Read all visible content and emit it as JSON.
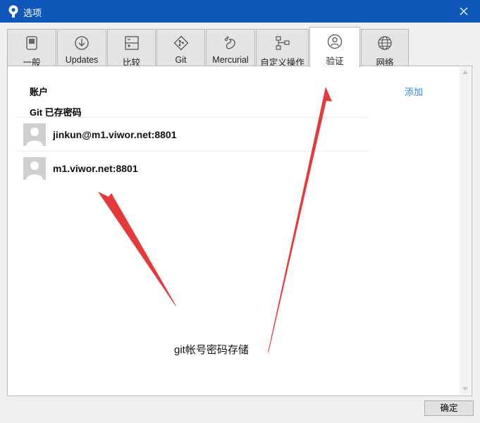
{
  "window": {
    "title": "选项"
  },
  "tabs": [
    {
      "label": "一般",
      "icon": "toggle-icon"
    },
    {
      "label": "Updates",
      "icon": "download-icon"
    },
    {
      "label": "比较",
      "icon": "diff-icon"
    },
    {
      "label": "Git",
      "icon": "git-icon"
    },
    {
      "label": "Mercurial",
      "icon": "mercurial-icon"
    },
    {
      "label": "自定义操作",
      "icon": "flow-icon"
    },
    {
      "label": "验证",
      "icon": "user-icon"
    },
    {
      "label": "网络",
      "icon": "globe-icon"
    }
  ],
  "active_tab": "验证",
  "panel": {
    "accounts_heading": "账户",
    "add_link": "添加",
    "git_saved_heading": "Git 已存密码",
    "saved_passwords": [
      {
        "label": "jinkun@m1.viwor.net:8801"
      },
      {
        "label": "m1.viwor.net:8801"
      }
    ]
  },
  "annotation": {
    "text": "git帐号密码存储",
    "color": "#e8393a"
  },
  "footer": {
    "ok_label": "确定"
  },
  "colors": {
    "titlebar": "#0f58b9",
    "link": "#2c85d8"
  }
}
